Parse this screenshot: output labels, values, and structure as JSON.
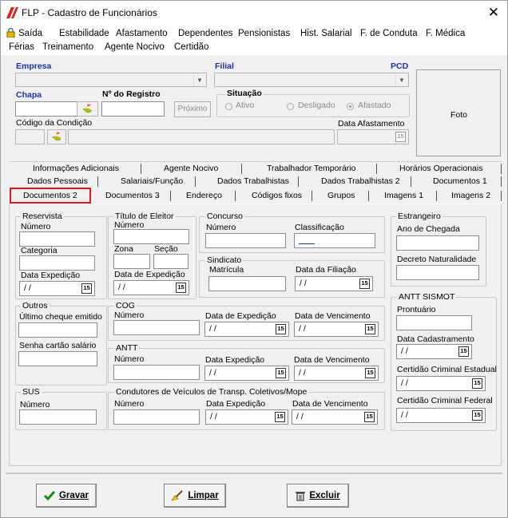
{
  "window": {
    "title": "FLP - Cadastro de Funcionários",
    "close_glyph": "✕"
  },
  "menu": {
    "row1": [
      "Saída",
      "Estabilidade",
      "Afastamento",
      "Dependentes",
      "Pensionistas",
      "Hist. Salarial",
      "F. de Conduta",
      "F. Médica"
    ],
    "row2": [
      "Férias",
      "Treinamento",
      "Agente Nocivo",
      "Certidão"
    ]
  },
  "header": {
    "empresa_label": "Empresa",
    "filial_label": "Filial",
    "pcd_label": "PCD",
    "chapa_label": "Chapa",
    "registro_label": "Nº do Registro",
    "proximo_label": "Próximo",
    "situacao_label": "Situação",
    "situacao_options": [
      "Ativo",
      "Desligado",
      "Afastado"
    ],
    "situacao_selected": "Afastado",
    "codigo_condicao_label": "Código da Condição",
    "data_afastamento_label": "Data Afastamento",
    "foto_label": "Foto",
    "cal_glyph": "15"
  },
  "tabs": {
    "row1": [
      "Informações Adicionais",
      "Agente Nocivo",
      "Trabalhador Temporário",
      "Horários Operacionais"
    ],
    "row2": [
      "Dados Pessoais",
      "Salariais/Função",
      "Dados Trabalhistas",
      "Dados Trabalhistas 2",
      "Documentos 1"
    ],
    "row3": [
      "Documentos 2",
      "Documentos 3",
      "Endereço",
      "Códigos fixos",
      "Grupos",
      "Imagens 1",
      "Imagens 2"
    ],
    "active": "Documentos 2"
  },
  "doc2": {
    "reservista": {
      "title": "Reservista",
      "numero": "Número",
      "categoria": "Categoria",
      "data_expedicao": "Data Expedição",
      "date_value": " / /"
    },
    "titulo": {
      "title": "Título de Eleitor",
      "numero": "Número",
      "zona": "Zona",
      "secao": "Seção",
      "data_expedicao": "Data de Expedição",
      "date_value": " / /"
    },
    "concurso": {
      "title": "Concurso",
      "numero": "Número",
      "classificacao": "Classificação"
    },
    "sindicato": {
      "title": "Sindicato",
      "matricula": "Matrícula",
      "data_filiacao": "Data da Filiação",
      "date_value": " / /"
    },
    "estrangeiro": {
      "title": "Estrangeiro",
      "ano_chegada": "Ano de Chegada",
      "decreto": "Decreto Naturalidade"
    },
    "outros": {
      "title": "Outros",
      "ultimo_cheque": "Último cheque emitido",
      "senha_cartao": "Senha cartão salário"
    },
    "cog": {
      "title": "COG",
      "numero": "Número",
      "data_expedicao": "Data de Expedição",
      "data_vencimento": "Data de Vencimento",
      "date_value": " / /"
    },
    "antt": {
      "title": "ANTT",
      "numero": "Número",
      "data_expedicao": "Data Expedição",
      "data_vencimento": "Data de Vencimento",
      "date_value": " / /"
    },
    "antt_sismot": {
      "title": "ANTT SISMOT",
      "prontuario": "Prontuário",
      "data_cadastramento": "Data Cadastramento",
      "certidao_estadual": "Certidão Criminal Estadual",
      "certidao_federal": "Certidão Criminal Federal",
      "date_value": " / /"
    },
    "sus": {
      "title": "SUS",
      "numero": "Número"
    },
    "condutores": {
      "title": "Condutores de Veículos de Transp. Coletivos/Mope",
      "numero": "Número",
      "data_expedicao": "Data Expedição",
      "data_vencimento": "Data de Vencimento",
      "date_value": " / /"
    }
  },
  "buttons": {
    "gravar": "Gravar",
    "limpar": "Limpar",
    "excluir": "Excluir"
  }
}
